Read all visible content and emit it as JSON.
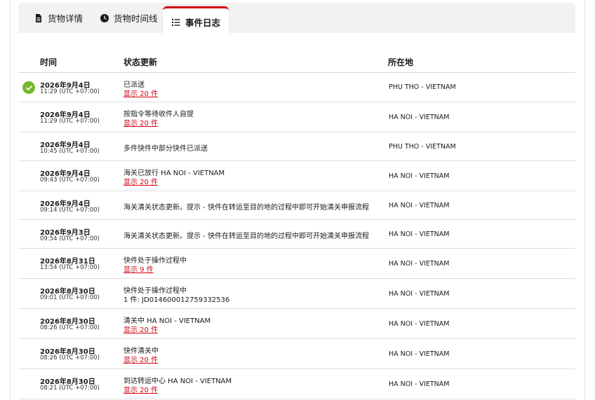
{
  "tabs": [
    {
      "label": "货物详情",
      "icon": "document-icon"
    },
    {
      "label": "货物时间线",
      "icon": "clock-icon"
    },
    {
      "label": "事件日志",
      "icon": "list-icon"
    }
  ],
  "table": {
    "headers": {
      "time": "时间",
      "status": "状态更新",
      "location": "所在地"
    },
    "rows": [
      {
        "date": "2026年9月4日",
        "time": "11:29 (UTC +07:00)",
        "status": "已派送",
        "sub": "显示 20 件",
        "sub_link": true,
        "location": "PHU THO - VIETNAM",
        "delivered": true
      },
      {
        "date": "2026年9月4日",
        "time": "11:29 (UTC +07:00)",
        "status": "按指令等待收件人自提",
        "sub": "显示 20 件",
        "sub_link": true,
        "location": "HA NOI - VIETNAM"
      },
      {
        "date": "2026年9月4日",
        "time": "10:45 (UTC +07:00)",
        "status": "多件快件中部分快件已派送",
        "sub": "",
        "sub_link": false,
        "location": "PHU THO - VIETNAM"
      },
      {
        "date": "2026年9月4日",
        "time": "09:43 (UTC +07:00)",
        "status": "海关已放行 HA NOI - VIETNAM",
        "sub": "显示 20 件",
        "sub_link": true,
        "location": "HA NOI - VIETNAM"
      },
      {
        "date": "2026年9月4日",
        "time": "09:14 (UTC +07:00)",
        "status": "海关清关状态更新。提示 - 快件在转运至目的地的过程中即可开始清关申报流程",
        "sub": "",
        "sub_link": false,
        "location": "HA NOI - VIETNAM"
      },
      {
        "date": "2026年9月3日",
        "time": "09:54 (UTC +07:00)",
        "status": "海关清关状态更新。提示 - 快件在转运至目的地的过程中即可开始清关申报流程",
        "sub": "",
        "sub_link": false,
        "location": "HA NOI - VIETNAM"
      },
      {
        "date": "2026年8月31日",
        "time": "13:54 (UTC +07:00)",
        "status": "快件处于操作过程中",
        "sub": "显示 9 件",
        "sub_link": true,
        "location": "HA NOI - VIETNAM"
      },
      {
        "date": "2026年8月30日",
        "time": "09:01 (UTC +07:00)",
        "status": "快件处于操作过程中",
        "sub": "1 件: JD014600012759332536",
        "sub_link": false,
        "location": "HA NOI - VIETNAM"
      },
      {
        "date": "2026年8月30日",
        "time": "08:26 (UTC +07:00)",
        "status": "清关中 HA NOI - VIETNAM",
        "sub": "显示 20 件",
        "sub_link": true,
        "location": "HA NOI - VIETNAM"
      },
      {
        "date": "2026年8月30日",
        "time": "08:26 (UTC +07:00)",
        "status": "快件清关中",
        "sub": "显示 20 件",
        "sub_link": true,
        "location": "HA NOI - VIETNAM"
      },
      {
        "date": "2026年8月30日",
        "time": "08:21 (UTC +07:00)",
        "status": "到达转运中心 HA NOI - VIETNAM",
        "sub": "显示 20 件",
        "sub_link": true,
        "location": "HA NOI - VIETNAM"
      }
    ]
  },
  "colors": {
    "accent": "#d40511",
    "delivered": "#76b82a"
  }
}
